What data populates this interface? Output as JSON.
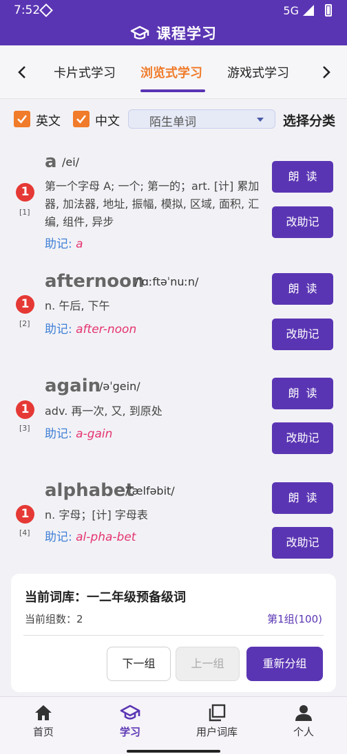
{
  "status": {
    "time": "7:52",
    "network": "5G"
  },
  "app": {
    "title": "课程学习"
  },
  "tabs": [
    {
      "label": "卡片式学习"
    },
    {
      "label": "浏览式学习"
    },
    {
      "label": "游戏式学习"
    }
  ],
  "filter": {
    "english_label": "英文",
    "chinese_label": "中文",
    "dropdown_value": "陌生单词",
    "category_label": "选择分类"
  },
  "words": [
    {
      "badge": "1",
      "index": "[1]",
      "word": "a",
      "phonetic": "/ei/",
      "definition": "第一个字母 A; 一个; 第一的；art. [计] 累加器, 加法器, 地址, 振幅, 模拟, 区域, 面积, 汇编, 组件, 异步",
      "mnemonic_label": "助记:",
      "mnemonic": "a",
      "read_label": "朗读",
      "edit_label": "改助记"
    },
    {
      "badge": "1",
      "index": "[2]",
      "word": "afternoon",
      "phonetic": "/ˈɑːftəˈnuːn/",
      "definition": "n. 午后, 下午",
      "mnemonic_label": "助记:",
      "mnemonic": "after-noon",
      "read_label": "朗读",
      "edit_label": "改助记"
    },
    {
      "badge": "1",
      "index": "[3]",
      "word": "again",
      "phonetic": "/əˈgein/",
      "definition": "adv. 再一次, 又, 到原处",
      "mnemonic_label": "助记:",
      "mnemonic": "a-gain",
      "read_label": "朗读",
      "edit_label": "改助记"
    },
    {
      "badge": "1",
      "index": "[4]",
      "word": "alphabet",
      "phonetic": "/ˈælfəbit/",
      "definition": "n. 字母；[计] 字母表",
      "mnemonic_label": "助记:",
      "mnemonic": "al-pha-bet",
      "read_label": "朗读",
      "edit_label": "改助记"
    }
  ],
  "panel": {
    "title": "当前词库：一二年级预备级词",
    "group_count": "当前组数：2",
    "group_info": "第1组(100)",
    "next_label": "下一组",
    "prev_label": "上一组",
    "regroup_label": "重新分组"
  },
  "nav": [
    {
      "label": "首页"
    },
    {
      "label": "学习"
    },
    {
      "label": "用户词库"
    },
    {
      "label": "个人"
    }
  ],
  "colors": {
    "primary": "#5a35b3",
    "accent": "#f07b2a",
    "badge": "#e53935",
    "mnemonic": "#e5336f",
    "mnemonic_label": "#3f7fd6"
  }
}
